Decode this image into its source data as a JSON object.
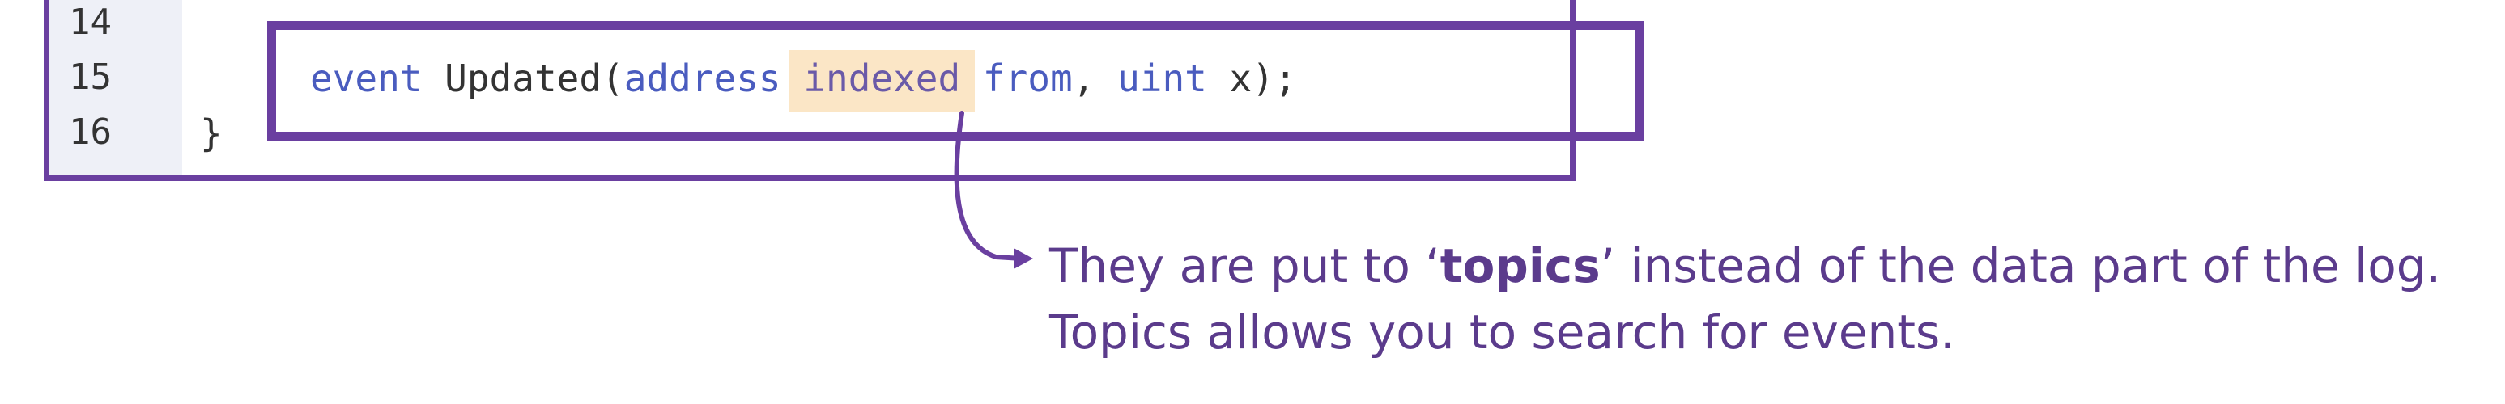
{
  "code": {
    "line_numbers": [
      "14",
      "15",
      "16"
    ],
    "line15": {
      "kw_event": "event",
      "name": " Updated(",
      "kw_address": "address",
      "space1": " ",
      "indexed": "indexed",
      "space2": " ",
      "from": "from",
      "comma": ", ",
      "kw_uint": "uint",
      "rest": " x);"
    },
    "line16": "}"
  },
  "note": {
    "line1_pre": "They are put to ‘",
    "line1_bold": "topics",
    "line1_post": "’ instead of the data part of the log.",
    "line2": "Topics allows you to search for events."
  },
  "colors": {
    "accent": "#6a3fa0",
    "keyword": "#4a5cbf",
    "highlight": "#fbe6c6",
    "note_text": "#5b3b8c"
  }
}
